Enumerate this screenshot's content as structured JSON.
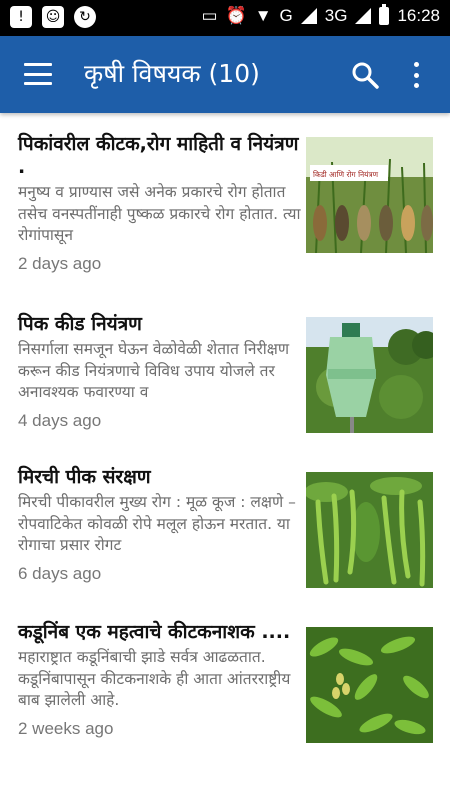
{
  "statusbar": {
    "network": "G",
    "network2": "3G",
    "time": "16:28"
  },
  "appbar": {
    "title": "कृषी विषयक (10)"
  },
  "articles": [
    {
      "title": "पिकांवरील कीटक,रोग माहिती व नियंत्रण  .",
      "desc": "मनुष्य व प्राण्यास जसे अनेक प्रकारचे रोग होतात तसेच वनस्पतींनाही पुष्कळ प्रकारचे रोग होतात.  त्या रोगांपासून",
      "time": "2 days ago",
      "thumb_caption": "किडी आणि रोग नियंत्रण"
    },
    {
      "title": "पिक कीड नियंत्रण",
      "desc": "निसर्गाला समजून घेऊन वेळोवेळी शेतात निरीक्षण करून  कीड नियंत्रणाचे विविध उपाय योजले तर अनावश्यक फवारण्या व",
      "time": "4 days ago"
    },
    {
      "title": "मिरची पीक संरक्षण",
      "desc": "मिरची पीकावरील मुख्य रोग : मूळ कूज : लक्षणे – रोपवाटिकेत कोवळी रोपे मलूल होऊन मरतात. या रोगाचा प्रसार रोगट",
      "time": "6 days ago"
    },
    {
      "title": "कडूनिंब एक महत्वाचे कीटकनाशक ....",
      "desc": "महाराष्ट्रात कडूनिंबाची झाडे सर्वत्र आढळतात. कडूनिंबापासून कीटकनाशके ही आता आंतरराष्ट्रीय बाब झालेली आहे.",
      "time": "2 weeks ago"
    }
  ],
  "colors": {
    "appbar": "#1e5ea9",
    "statusbar": "#000000"
  }
}
